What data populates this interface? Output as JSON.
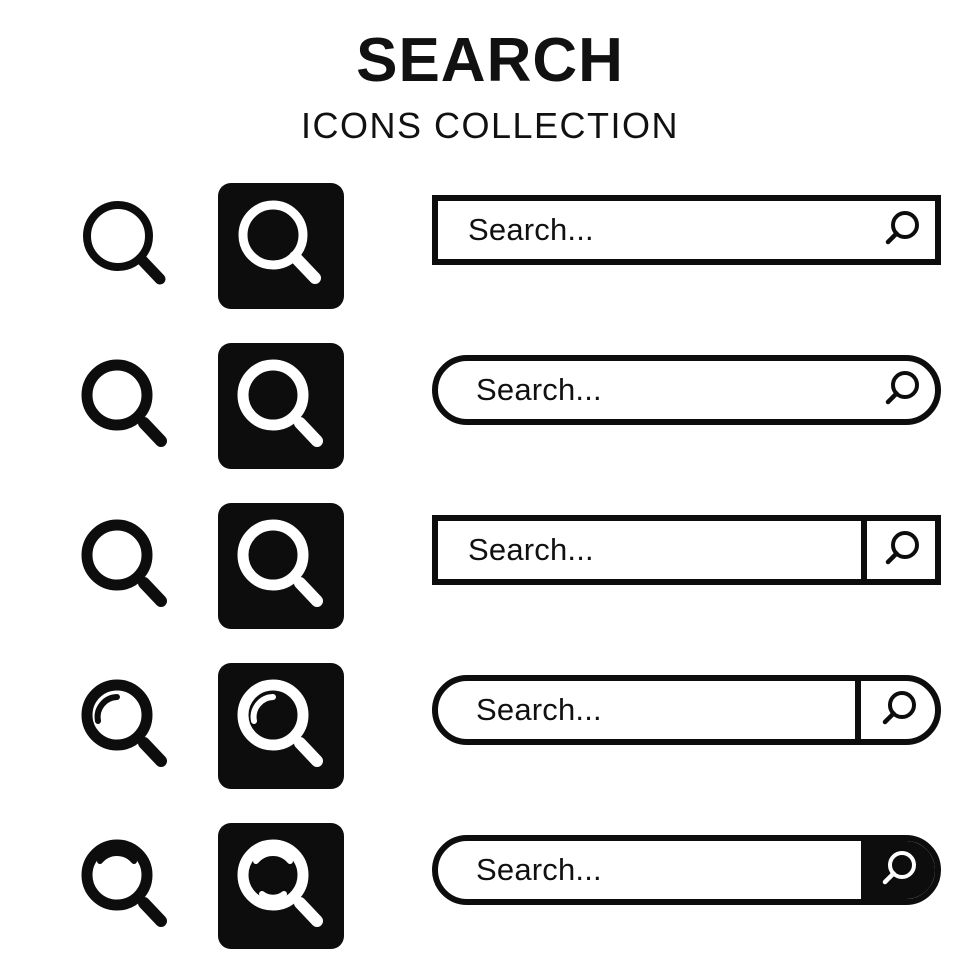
{
  "header": {
    "title": "SEARCH",
    "subtitle": "ICONS COLLECTION"
  },
  "colors": {
    "ink": "#0d0d0d",
    "background": "#ffffff",
    "icon_fill": "#ffffff"
  },
  "rows": [
    {
      "index": 1,
      "outline_icon_name": "magnifier-thin-attached-handle",
      "solid_icon_name": "magnifier-thin-attached-handle-inverted",
      "bar": {
        "shape": "rectangle",
        "placeholder": "Search...",
        "icon_name": "search-icon",
        "icon_style": "plain",
        "divider": false,
        "filled_button": false
      }
    },
    {
      "index": 2,
      "outline_icon_name": "magnifier-thick-detached-handle",
      "solid_icon_name": "magnifier-thick-detached-handle-inverted",
      "bar": {
        "shape": "pill",
        "placeholder": "Search...",
        "icon_name": "search-icon",
        "icon_style": "plain",
        "divider": false,
        "filled_button": false
      }
    },
    {
      "index": 3,
      "outline_icon_name": "magnifier-thick-detached-handle-alt",
      "solid_icon_name": "magnifier-thick-detached-handle-alt-inverted",
      "bar": {
        "shape": "rectangle",
        "placeholder": "Search...",
        "icon_name": "search-icon",
        "icon_style": "divided",
        "divider": true,
        "filled_button": false
      }
    },
    {
      "index": 4,
      "outline_icon_name": "magnifier-with-glare-arc",
      "solid_icon_name": "magnifier-with-glare-arc-inverted",
      "bar": {
        "shape": "pill",
        "placeholder": "Search...",
        "icon_name": "search-icon",
        "icon_style": "divided",
        "divider": true,
        "filled_button": false
      }
    },
    {
      "index": 5,
      "outline_icon_name": "magnifier-with-top-glare-arc",
      "solid_icon_name": "magnifier-with-top-and-bottom-glare-inverted",
      "bar": {
        "shape": "pill",
        "placeholder": "Search...",
        "icon_name": "search-icon",
        "icon_style": "filled-button",
        "divider": false,
        "filled_button": true
      }
    }
  ]
}
